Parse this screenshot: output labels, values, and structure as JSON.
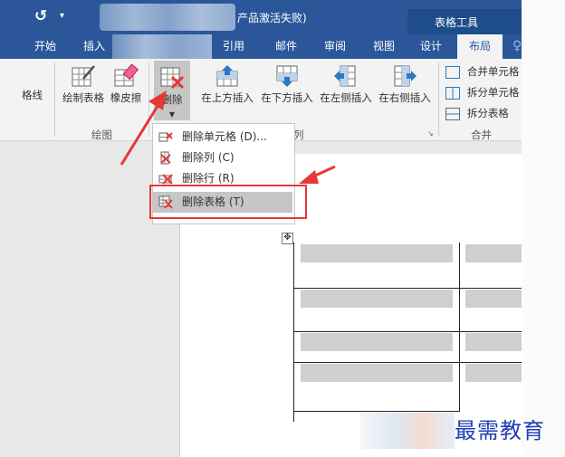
{
  "titlebar": {
    "title_fragment": "产品激活失败)",
    "table_tools": "表格工具",
    "quick_access_icon": "undo-redo-icon",
    "dropdown_glyph": "▾"
  },
  "tabs": [
    {
      "label": "开始"
    },
    {
      "label": "插入"
    },
    {
      "label": "引用"
    },
    {
      "label": "邮件"
    },
    {
      "label": "审阅"
    },
    {
      "label": "视图"
    },
    {
      "label": "设计"
    },
    {
      "label": "布局"
    }
  ],
  "ribbon": {
    "gridlines_label": "格线",
    "draw": {
      "draw_table": "绘制表格",
      "eraser": "橡皮擦",
      "group_label": "绘图"
    },
    "rows_cols": {
      "delete": "删除",
      "insert_above": "在上方插入",
      "insert_below": "在下方插入",
      "insert_left": "在左侧插入",
      "insert_right": "在右侧插入",
      "group_label_fragment": "列"
    },
    "merge": {
      "merge_cells": "合并单元格",
      "split_cells": "拆分单元格",
      "split_table": "拆分表格",
      "group_label": "合并"
    }
  },
  "delete_menu": {
    "items": [
      {
        "label": "删除单元格 (D)..."
      },
      {
        "label": "删除列 (C)"
      },
      {
        "label": "删除行 (R)"
      },
      {
        "label": "删除表格 (T)"
      }
    ],
    "highlighted_index": 3
  },
  "watermark": "最需教育",
  "colors": {
    "ribbon_blue": "#2b579a",
    "annotation_red": "#e53935",
    "watermark_blue": "#1d3fb3"
  }
}
